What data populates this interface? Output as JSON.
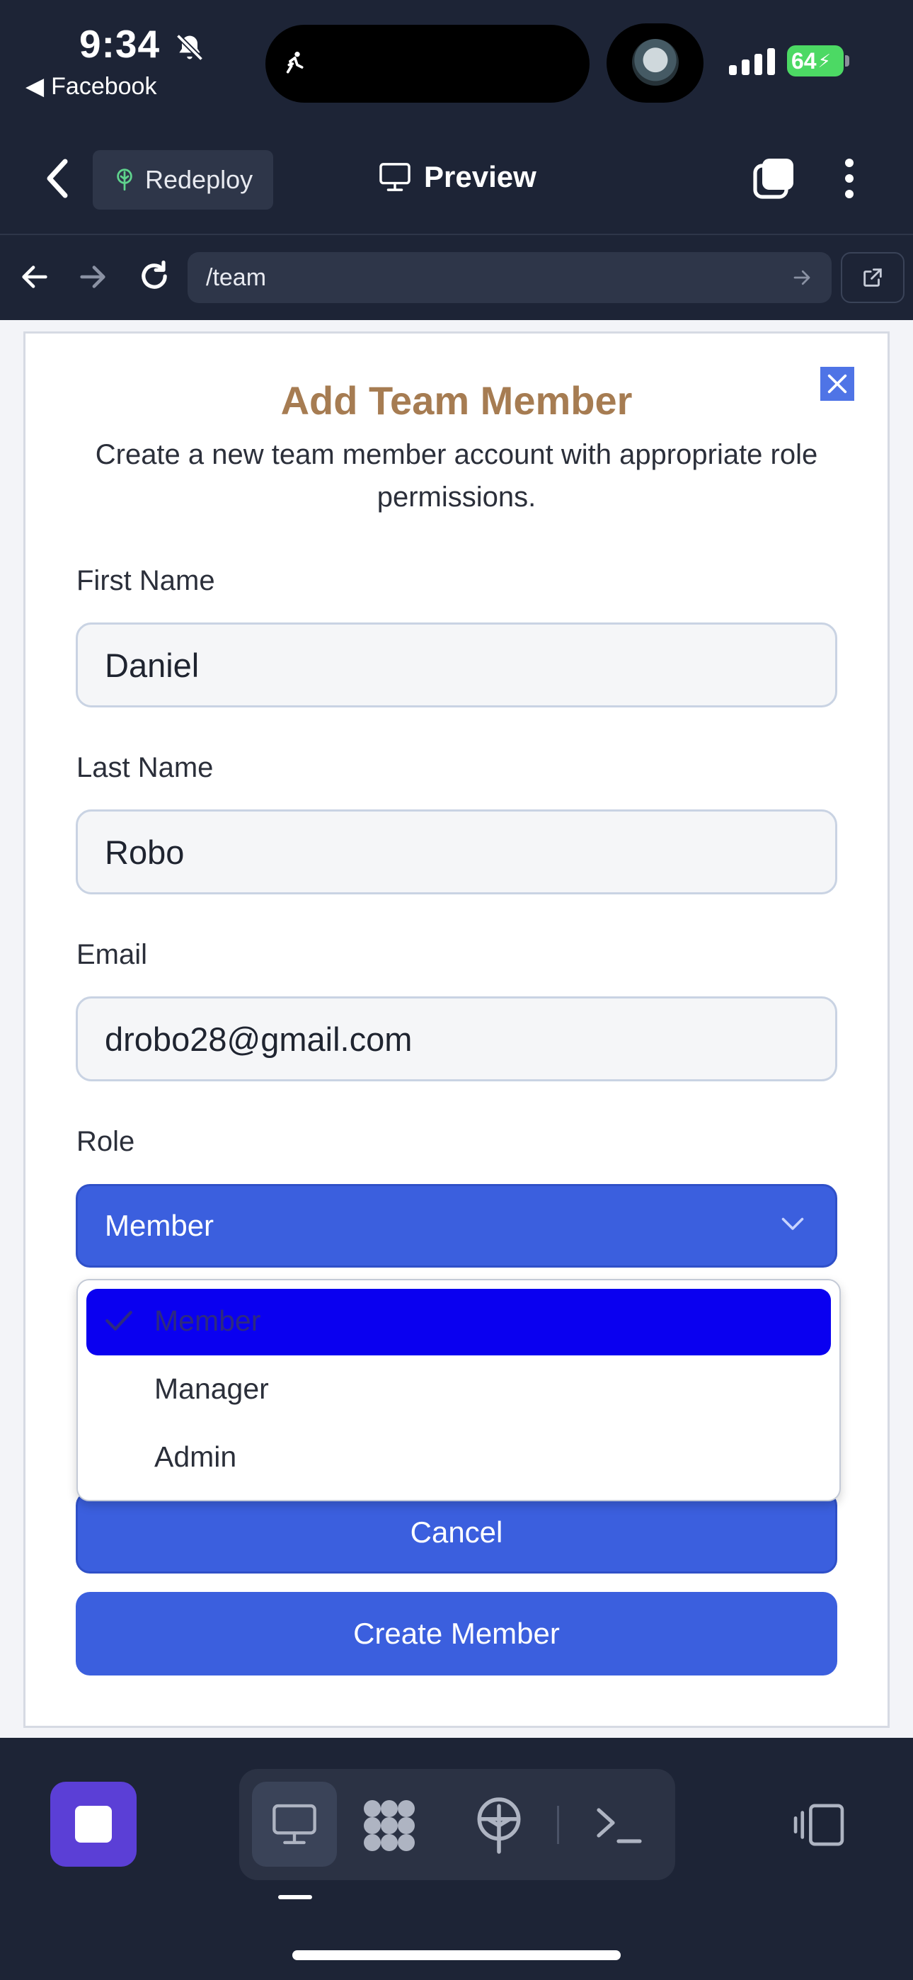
{
  "status_bar": {
    "time": "9:34",
    "back_app": "Facebook",
    "battery": "64"
  },
  "header": {
    "redeploy_label": "Redeploy",
    "preview_label": "Preview"
  },
  "url_bar": {
    "path": "/team"
  },
  "modal": {
    "title": "Add Team Member",
    "description": "Create a new team member account with appropriate role permissions.",
    "fields": {
      "first_name": {
        "label": "First Name",
        "value": "Daniel"
      },
      "last_name": {
        "label": "Last Name",
        "value": "Robo"
      },
      "email": {
        "label": "Email",
        "value": "drobo28@gmail.com"
      },
      "role": {
        "label": "Role",
        "value": "Member"
      }
    },
    "role_options": [
      "Member",
      "Manager",
      "Admin"
    ],
    "cancel_label": "Cancel",
    "submit_label": "Create Member"
  },
  "colors": {
    "accent": "#3b5fde",
    "title": "#a67c52",
    "app_bg": "#1d2436",
    "stop_button": "#5b3fd6",
    "selected_option": "#0a00f0"
  },
  "icons": {
    "status": [
      "bell-slash-icon",
      "runner-icon",
      "signal-icon",
      "battery-icon"
    ],
    "header": [
      "chevron-left-icon",
      "tree-icon",
      "monitor-icon",
      "tabs-icon",
      "more-vertical-icon"
    ],
    "url_bar": [
      "arrow-left-icon",
      "arrow-right-icon",
      "reload-icon",
      "open-external-icon"
    ],
    "toolbar": [
      "stop-icon",
      "monitor-icon",
      "apps-icon",
      "deploy-icon",
      "terminal-icon",
      "devices-icon"
    ]
  }
}
